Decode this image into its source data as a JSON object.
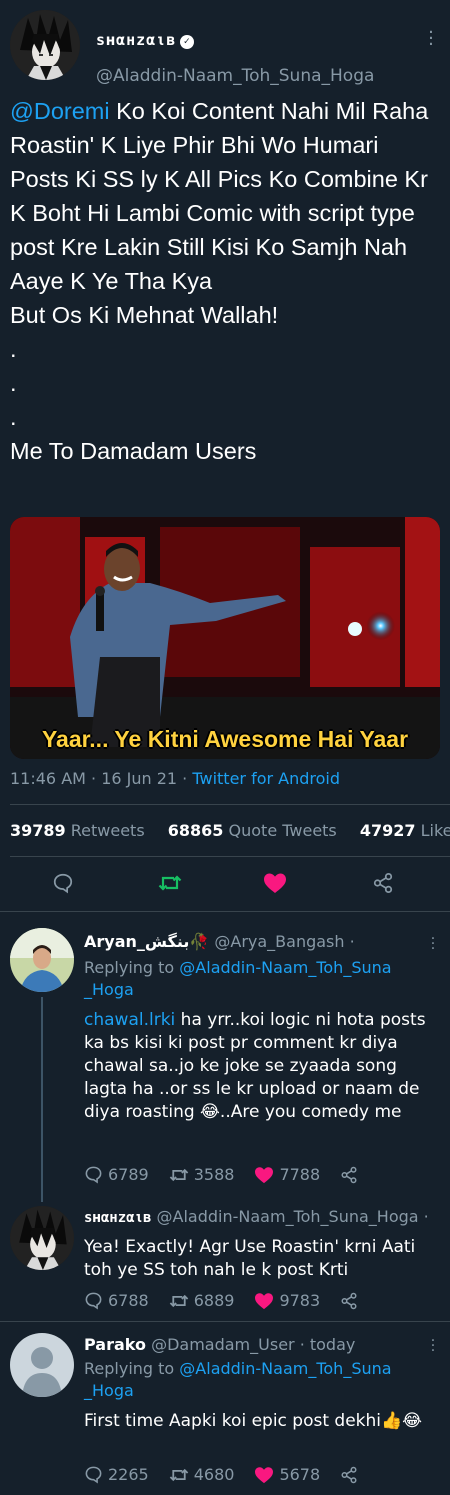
{
  "main_tweet": {
    "display_name": "sʜαнzαιв",
    "handle": "@Aladdin-Naam_Toh_Suna_Hoga",
    "mention": "@Doremi",
    "body": " Ko Koi Content Nahi Mil Raha Roastin' K Liye Phir Bhi Wo Humari Posts Ki SS ly K All Pics Ko Combine Kr K Boht Hi Lambi Comic with script type post Kre Lakin Still Kisi Ko Samjh Nah Aaye K Ye Tha Kya\nBut Os Ki Mehnat Wallah!\n.\n.\n.\nMe To Damadam Users",
    "media_caption": "Yaar... Ye Kitni Awesome Hai Yaar",
    "time": "11:46 AM · 16 Jun 21 · ",
    "client": "Twitter for Android",
    "retweets": "39789",
    "retweets_label": "Retweets",
    "quotes": "68865",
    "quotes_label": "Quote Tweets",
    "likes": "47927",
    "likes_label": "Likes"
  },
  "replies": [
    {
      "name": "Aryan_بنگش",
      "emoji": "🥀",
      "handle": "@Arya_Bangash ·",
      "replying_prefix": "Replying to ",
      "replying_to": "@Aladdin-Naam_Toh_Suna",
      "replying_to_cont": "_Hoga",
      "mention": "chawal.lrki",
      "text": " ha yrr..koi logic ni hota posts ka bs kisi ki post pr comment kr diya chawal sa..jo ke joke se zyaada song lagta ha ..or ss le kr upload or naam de diya roasting 😂..Are you comedy me",
      "replies": "6789",
      "retweets": "3588",
      "likes": "7788"
    },
    {
      "name": "sʜαнzαιв",
      "handle": "@Aladdin-Naam_Toh_Suna_Hoga ·",
      "text": "Yea! Exactly! Agr Use Roastin' krni Aati toh ye SS toh nah le k post Krti",
      "replies": "6788",
      "retweets": "6889",
      "likes": "9783"
    },
    {
      "name": "Parako",
      "handle": "@Damadam_User · today",
      "replying_prefix": "Replying to ",
      "replying_to": "@Aladdin-Naam_Toh_Suna",
      "replying_to_cont": "_Hoga",
      "text": "First time Aapki koi epic post dekhi👍😂",
      "replies": "2265",
      "retweets": "4680",
      "likes": "5678"
    }
  ],
  "colors": {
    "background": "#15202b",
    "link": "#1da1f2",
    "muted": "#8899a6",
    "like": "#f91880",
    "retweet": "#17bf63"
  }
}
